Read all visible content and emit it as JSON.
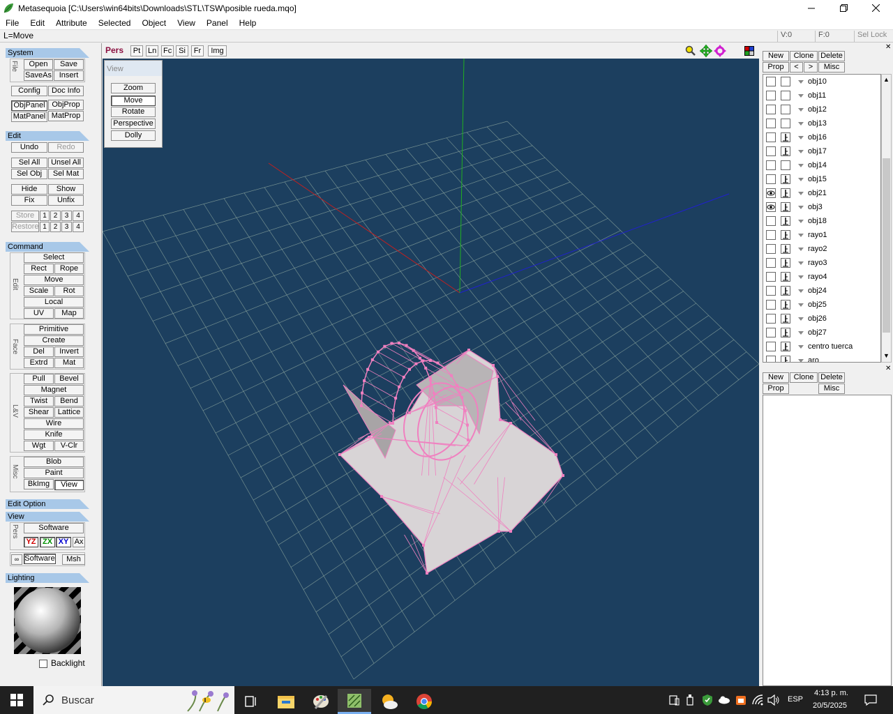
{
  "window": {
    "title": "Metasequoia [C:\\Users\\win64bits\\Downloads\\STL\\TSW\\posible rueda.mqo]",
    "controls": [
      "minimize",
      "maximize",
      "close"
    ]
  },
  "menubar": [
    "File",
    "Edit",
    "Attribute",
    "Selected",
    "Object",
    "View",
    "Panel",
    "Help"
  ],
  "status": {
    "mode": "L=Move",
    "vertex": "V:0",
    "face": "F:0",
    "sel_lock": "Sel Lock"
  },
  "left_panel": {
    "system": {
      "title": "System",
      "file_label": "File",
      "buttons": [
        "Open",
        "Save",
        "SaveAs",
        "Insert",
        "Config",
        "Doc Info",
        "ObjPanel",
        "ObjProp",
        "MatPanel",
        "MatProp"
      ]
    },
    "edit": {
      "title": "Edit",
      "buttons": [
        "Undo",
        "Redo",
        "Sel All",
        "Unsel All",
        "Sel Obj",
        "Sel Mat",
        "Hide",
        "Show",
        "Fix",
        "Unfix"
      ],
      "store_label": "Store",
      "restore_label": "Restore",
      "slots": [
        "1",
        "2",
        "3",
        "4"
      ]
    },
    "command": {
      "title": "Command",
      "edit_label": "Edit",
      "edit_buttons": [
        "Select",
        "Rect",
        "Rope",
        "Move",
        "Scale",
        "Rot",
        "Local",
        "UV",
        "Map"
      ],
      "face_label": "Face",
      "face_buttons": [
        "Primitive",
        "Create",
        "Del",
        "Invert",
        "Extrd",
        "Mat"
      ],
      "lv_label": "L&V",
      "lv_buttons": [
        "Pull",
        "Bevel",
        "Magnet",
        "Twist",
        "Bend",
        "Shear",
        "Lattice",
        "Wire",
        "Knife",
        "Wgt",
        "V-Clr"
      ],
      "misc_label": "Misc",
      "misc_buttons": [
        "Blob",
        "Paint",
        "BkImg",
        "View"
      ]
    },
    "edit_option": {
      "title": "Edit Option"
    },
    "view": {
      "title": "View",
      "pers_label": "Pers",
      "software1": "Software",
      "axes": [
        "YZ",
        "ZX",
        "XY",
        "Ax"
      ],
      "software2": "Software",
      "msh": "Msh",
      "axis_colors": {
        "YZ": "#d00000",
        "ZX": "#009000",
        "XY": "#0000d0"
      }
    },
    "lighting": {
      "title": "Lighting",
      "backlight": "Backlight"
    }
  },
  "viewport": {
    "tabs": [
      "Pers",
      "Pt",
      "Ln",
      "Fc",
      "Si",
      "Fr",
      "Img"
    ],
    "view_panel": {
      "title": "View",
      "buttons": [
        "Zoom",
        "Move",
        "Rotate",
        "Perspective",
        "Dolly"
      ],
      "active": "Move"
    },
    "background": "#1c3f5f",
    "grid_color": "#8fa9a0",
    "mesh_color": "#f080c0"
  },
  "right_panel": {
    "obj_buttons": [
      "New",
      "Clone",
      "Delete",
      "Prop",
      "<",
      ">",
      "Misc"
    ],
    "objects": [
      {
        "name": "obj10",
        "visible": false,
        "locked": false
      },
      {
        "name": "obj11",
        "visible": false,
        "locked": false
      },
      {
        "name": "obj12",
        "visible": false,
        "locked": false
      },
      {
        "name": "obj13",
        "visible": false,
        "locked": false
      },
      {
        "name": "obj16",
        "visible": false,
        "locked": true
      },
      {
        "name": "obj17",
        "visible": false,
        "locked": true
      },
      {
        "name": "obj14",
        "visible": false,
        "locked": false
      },
      {
        "name": "obj15",
        "visible": false,
        "locked": true
      },
      {
        "name": "obj21",
        "visible": true,
        "locked": true
      },
      {
        "name": "obj3",
        "visible": true,
        "locked": true
      },
      {
        "name": "obj18",
        "visible": false,
        "locked": true
      },
      {
        "name": "rayo1",
        "visible": false,
        "locked": true
      },
      {
        "name": "rayo2",
        "visible": false,
        "locked": true
      },
      {
        "name": "rayo3",
        "visible": false,
        "locked": true
      },
      {
        "name": "rayo4",
        "visible": false,
        "locked": true
      },
      {
        "name": "obj24",
        "visible": false,
        "locked": true
      },
      {
        "name": "obj25",
        "visible": false,
        "locked": true
      },
      {
        "name": "obj26",
        "visible": false,
        "locked": true
      },
      {
        "name": "obj27",
        "visible": false,
        "locked": true
      },
      {
        "name": "centro tuerca",
        "visible": false,
        "locked": true
      },
      {
        "name": "aro",
        "visible": false,
        "locked": true
      }
    ],
    "mat_buttons": [
      "New",
      "Clone",
      "Delete",
      "Prop",
      "Misc"
    ]
  },
  "taskbar": {
    "search_placeholder": "Buscar",
    "language": "ESP",
    "time": "4:13 p. m.",
    "date": "20/5/2025"
  }
}
